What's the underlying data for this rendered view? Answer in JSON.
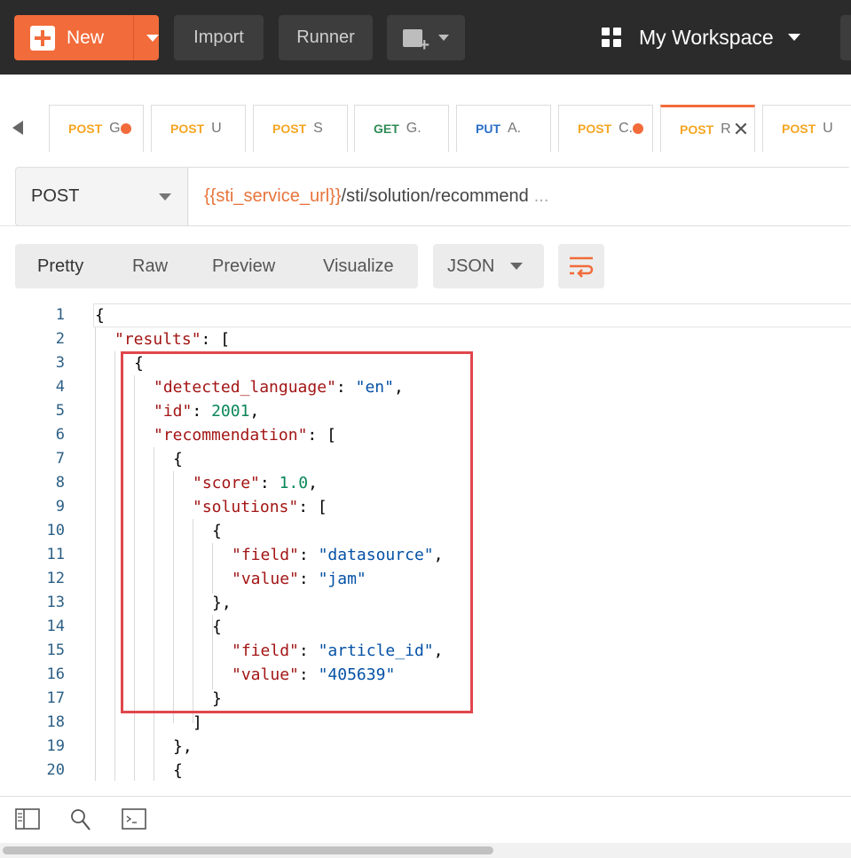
{
  "topbar": {
    "new_label": "New",
    "import_label": "Import",
    "runner_label": "Runner",
    "workspace_label": "My Workspace"
  },
  "tabs": [
    {
      "method": "POST",
      "name": "G",
      "unsaved": true
    },
    {
      "method": "POST",
      "name": "U",
      "unsaved": false
    },
    {
      "method": "POST",
      "name": "S",
      "unsaved": false
    },
    {
      "method": "GET",
      "name": "G.",
      "unsaved": false
    },
    {
      "method": "PUT",
      "name": "A.",
      "unsaved": false
    },
    {
      "method": "POST",
      "name": "C.",
      "unsaved": true
    },
    {
      "method": "POST",
      "name": "R",
      "unsaved": false,
      "active": true
    },
    {
      "method": "POST",
      "name": "U",
      "unsaved": false
    }
  ],
  "request": {
    "method": "POST",
    "url_variable": "{{sti_service_url}}",
    "url_path": "/sti/solution/recommend",
    "url_ellipsis": "..."
  },
  "response_toolbar": {
    "tabs": [
      "Pretty",
      "Raw",
      "Preview",
      "Visualize"
    ],
    "format": "JSON"
  },
  "code_lines": [
    {
      "n": "1",
      "indent": 0,
      "text": "{"
    },
    {
      "n": "2",
      "indent": 1,
      "key": "results",
      "tail": ": ["
    },
    {
      "n": "3",
      "indent": 2,
      "text": "{"
    },
    {
      "n": "4",
      "indent": 3,
      "key": "detected_language",
      "str": "en",
      "tail": ","
    },
    {
      "n": "5",
      "indent": 3,
      "key": "id",
      "num": "2001",
      "tail": ","
    },
    {
      "n": "6",
      "indent": 3,
      "key": "recommendation",
      "tail": ": ["
    },
    {
      "n": "7",
      "indent": 4,
      "text": "{"
    },
    {
      "n": "8",
      "indent": 5,
      "key": "score",
      "num": "1.0",
      "tail": ","
    },
    {
      "n": "9",
      "indent": 5,
      "key": "solutions",
      "tail": ": ["
    },
    {
      "n": "10",
      "indent": 6,
      "text": "{"
    },
    {
      "n": "11",
      "indent": 7,
      "key": "field",
      "str": "datasource",
      "tail": ","
    },
    {
      "n": "12",
      "indent": 7,
      "key": "value",
      "str": "jam",
      "tail": ""
    },
    {
      "n": "13",
      "indent": 6,
      "text": "},"
    },
    {
      "n": "14",
      "indent": 6,
      "text": "{"
    },
    {
      "n": "15",
      "indent": 7,
      "key": "field",
      "str": "article_id",
      "tail": ","
    },
    {
      "n": "16",
      "indent": 7,
      "key": "value",
      "str": "405639",
      "tail": ""
    },
    {
      "n": "17",
      "indent": 6,
      "text": "}"
    },
    {
      "n": "18",
      "indent": 5,
      "text": "]"
    },
    {
      "n": "19",
      "indent": 4,
      "text": "},"
    },
    {
      "n": "20",
      "indent": 4,
      "text": "{"
    }
  ],
  "statusbar": {
    "icons": [
      "sidebar-toggle-icon",
      "find-icon",
      "console-icon"
    ]
  }
}
